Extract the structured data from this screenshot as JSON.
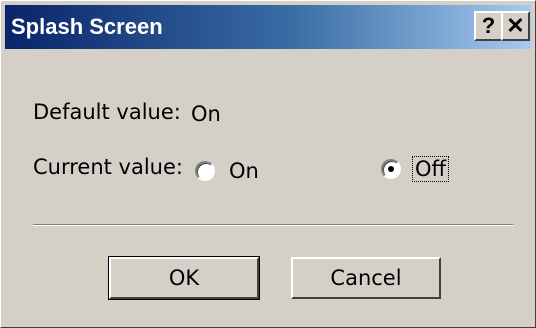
{
  "window": {
    "title": "Splash Screen",
    "help_button": "?",
    "close_button": "✕"
  },
  "settings": {
    "default_label": "Default value:",
    "default_value": "On",
    "current_label": "Current value:",
    "options": [
      {
        "label": "On",
        "selected": false
      },
      {
        "label": "Off",
        "selected": true
      }
    ]
  },
  "buttons": {
    "ok": "OK",
    "cancel": "Cancel"
  },
  "colors": {
    "titlebar_start": "#0a246a",
    "titlebar_end": "#a6caf0",
    "face": "#d4d0c8"
  }
}
